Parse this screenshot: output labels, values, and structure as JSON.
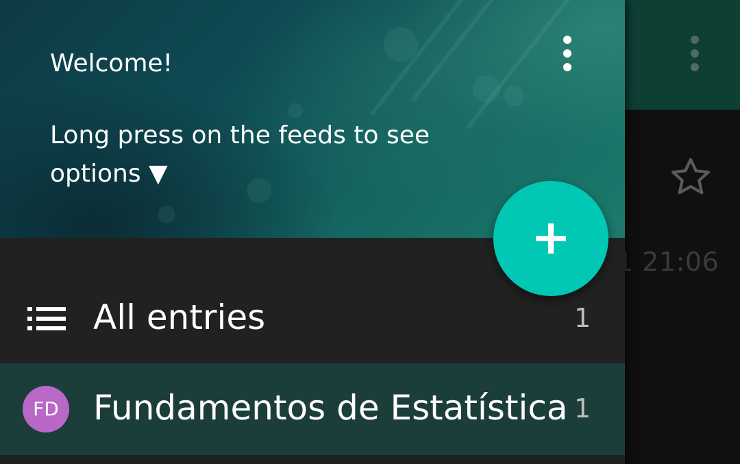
{
  "colors": {
    "drawer_bg": "#212121",
    "selected_bg": "#1c3e3a",
    "accent_fab": "#00c8b4",
    "avatar_bg": "#ba68c8",
    "toolbar_bg": "#0d3f35"
  },
  "background": {
    "overflow_icon": "more-vert-icon",
    "star_icon": "star-outline-icon",
    "entry_time_partial": "1 21:06"
  },
  "drawer": {
    "header": {
      "welcome": "Welcome!",
      "hint": "Long press on the feeds to see options ▼",
      "overflow_icon": "more-vert-icon"
    },
    "fab_icon": "plus-icon",
    "items": [
      {
        "label": "All entries",
        "count": "1",
        "icon": "list-icon"
      },
      {
        "label": "Fundamentos de Estatística",
        "count": "1",
        "avatar": "FD",
        "selected": true
      }
    ]
  }
}
